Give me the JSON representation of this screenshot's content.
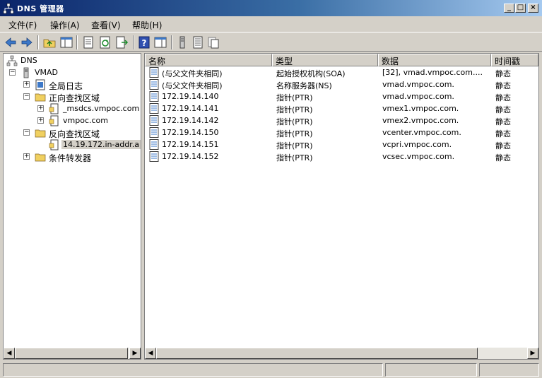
{
  "window": {
    "title": "DNS 管理器"
  },
  "menu": [
    "文件(F)",
    "操作(A)",
    "查看(V)",
    "帮助(H)"
  ],
  "tree": {
    "root": "DNS",
    "server": "VMAD",
    "global_logs": "全局日志",
    "forward_zones": "正向查找区域",
    "forward_children": [
      "_msdcs.vmpoc.com",
      "vmpoc.com"
    ],
    "reverse_zones": "反向查找区域",
    "reverse_selected": "14.19.172.in-addr.a",
    "conditional": "条件转发器"
  },
  "columns": [
    "名称",
    "类型",
    "数据",
    "时间戳"
  ],
  "records": [
    {
      "name": "(与父文件夹相同)",
      "type": "起始授权机构(SOA)",
      "data": "[32], vmad.vmpoc.com....",
      "ts": "静态"
    },
    {
      "name": "(与父文件夹相同)",
      "type": "名称服务器(NS)",
      "data": "vmad.vmpoc.com.",
      "ts": "静态"
    },
    {
      "name": "172.19.14.140",
      "type": "指针(PTR)",
      "data": "vmad.vmpoc.com.",
      "ts": "静态"
    },
    {
      "name": "172.19.14.141",
      "type": "指针(PTR)",
      "data": "vmex1.vmpoc.com.",
      "ts": "静态"
    },
    {
      "name": "172.19.14.142",
      "type": "指针(PTR)",
      "data": "vmex2.vmpoc.com.",
      "ts": "静态"
    },
    {
      "name": "172.19.14.150",
      "type": "指针(PTR)",
      "data": "vcenter.vmpoc.com.",
      "ts": "静态"
    },
    {
      "name": "172.19.14.151",
      "type": "指针(PTR)",
      "data": "vcpri.vmpoc.com.",
      "ts": "静态"
    },
    {
      "name": "172.19.14.152",
      "type": "指针(PTR)",
      "data": "vcsec.vmpoc.com.",
      "ts": "静态"
    }
  ],
  "colors": {
    "title_start": "#0a246a",
    "title_end": "#a6caf0",
    "chrome": "#d4d0c8"
  }
}
